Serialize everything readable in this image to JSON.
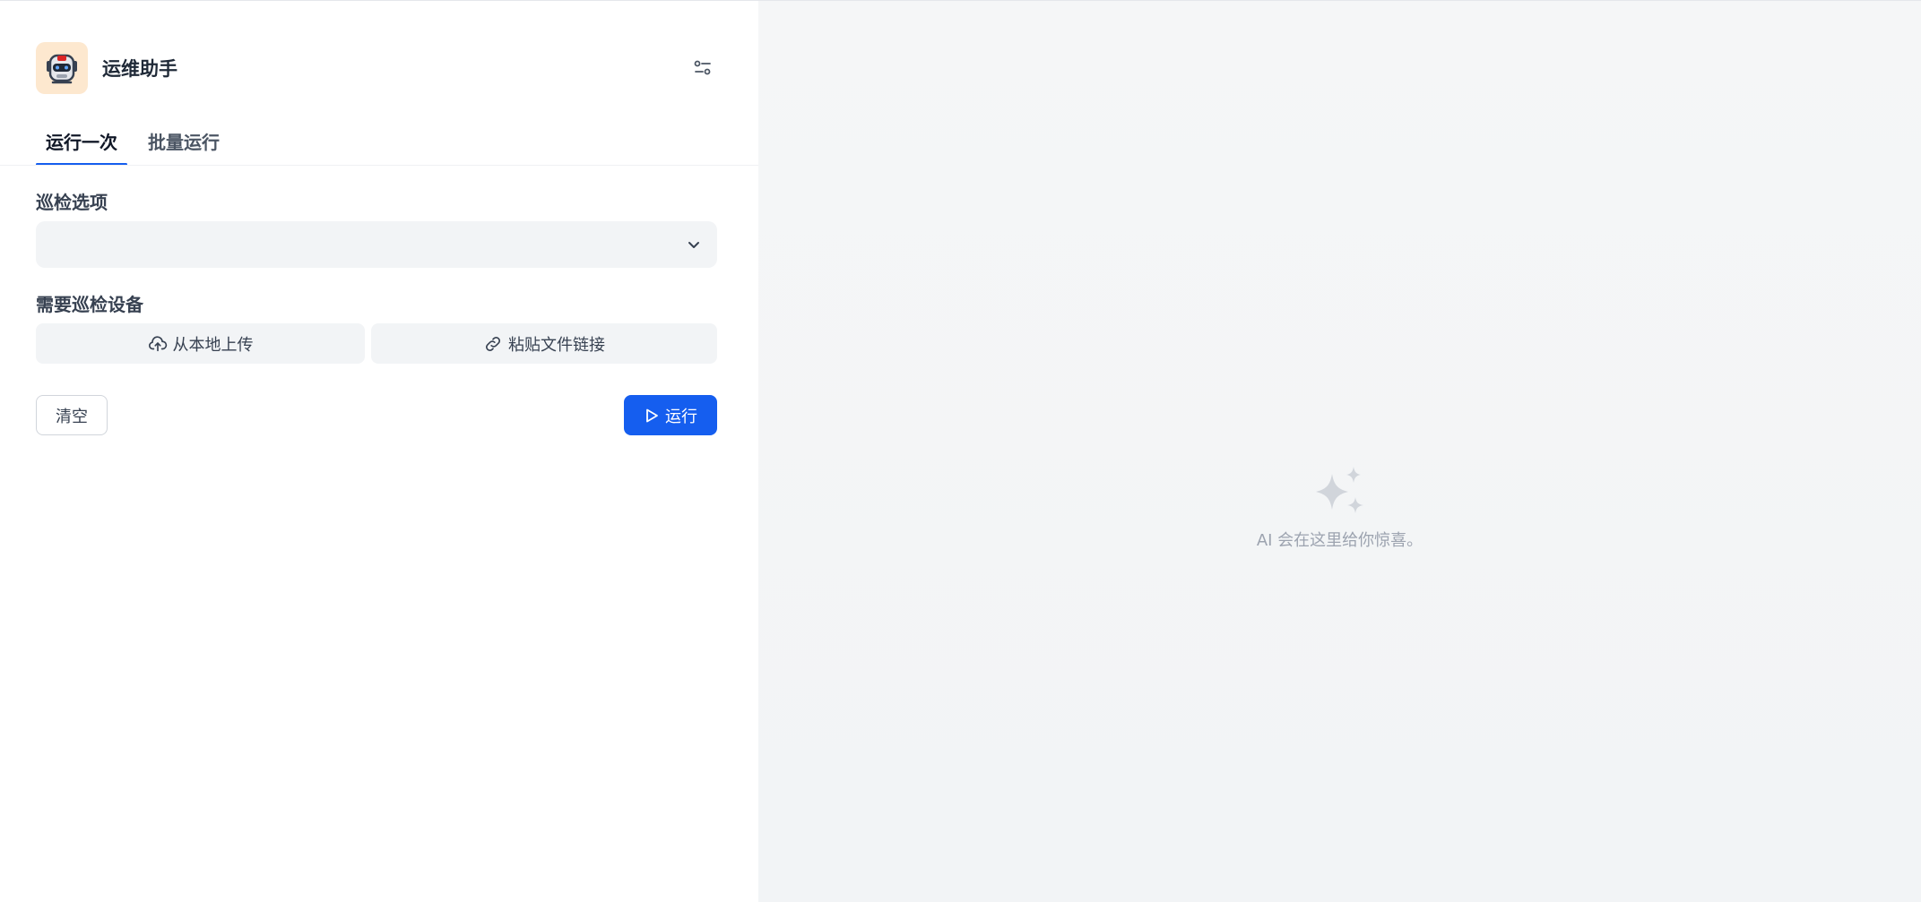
{
  "app": {
    "title": "运维助手",
    "logo_icon": "robot-icon",
    "settings_icon": "sliders-icon"
  },
  "tabs": [
    {
      "label": "运行一次",
      "active": true
    },
    {
      "label": "批量运行",
      "active": false
    }
  ],
  "form": {
    "inspection_options": {
      "label": "巡检选项",
      "value": "",
      "icon": "chevron-down-icon"
    },
    "devices": {
      "label": "需要巡检设备",
      "upload_local_label": "从本地上传",
      "upload_local_icon": "cloud-upload-icon",
      "paste_link_label": "粘贴文件链接",
      "paste_link_icon": "link-icon"
    },
    "clear_label": "清空",
    "run_label": "运行",
    "run_icon": "play-icon"
  },
  "output": {
    "empty_icon": "sparkles-icon",
    "empty_text": "AI 会在这里给你惊喜。"
  },
  "colors": {
    "accent": "#155eef",
    "logo_bg": "#fde8cf",
    "panel_bg": "#f2f4f6"
  }
}
